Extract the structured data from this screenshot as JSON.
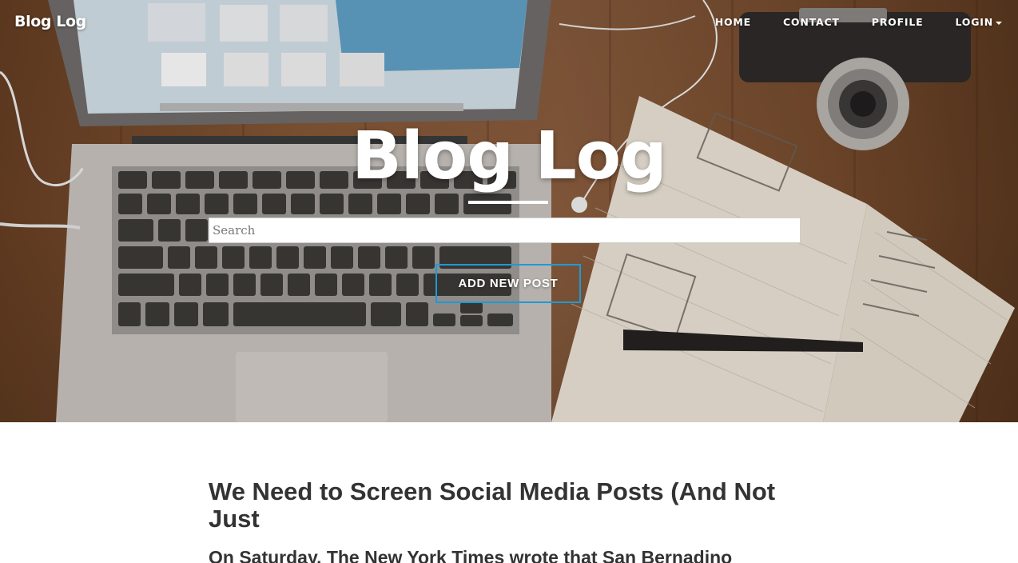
{
  "navbar": {
    "brand": "Blog Log",
    "items": [
      {
        "label": "HOME"
      },
      {
        "label": "CONTACT"
      },
      {
        "label": "PROFILE"
      },
      {
        "label": "LOGIN"
      }
    ]
  },
  "hero": {
    "title": "Blog Log",
    "search_placeholder": "Search",
    "add_button_label": "ADD NEW POST"
  },
  "post": {
    "title": "We Need to Screen Social Media Posts (And Not Just",
    "subtitle": "On Saturday, The New York Times wrote that San Bernadino"
  },
  "colors": {
    "accent": "#1e9ad6",
    "text_dark": "#333333",
    "hero_text": "#ffffff"
  },
  "icons": {
    "login_dropdown": "caret-down-icon"
  }
}
